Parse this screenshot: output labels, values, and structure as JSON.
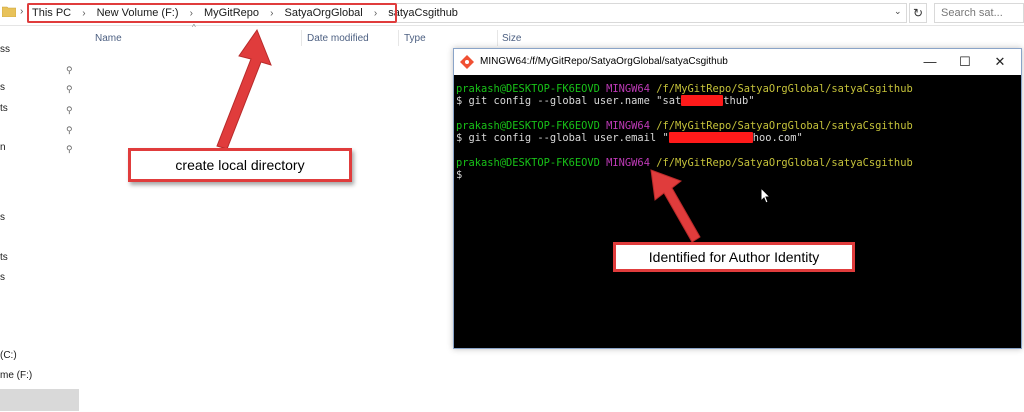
{
  "address_bar": {
    "crumbs": [
      "This PC",
      "New Volume (F:)",
      "MyGitRepo",
      "SatyaOrgGlobal",
      "satyaCsgithub"
    ],
    "search_placeholder": "Search sat..."
  },
  "nav": {
    "items": [
      "ss",
      "s",
      "ts",
      "",
      "n",
      "",
      "s",
      "",
      "ts",
      "s",
      "(C:)",
      "me (F:)"
    ]
  },
  "columns": [
    "Name",
    "Date modified",
    "Type",
    "Size"
  ],
  "callouts": {
    "local_dir": "create local directory",
    "author_identity": "Identified for Author Identity"
  },
  "terminal": {
    "title": "MINGW64:/f/MyGitRepo/SatyaOrgGlobal/satyaCsgithub",
    "user_host": "prakash@DESKTOP-FK6EOVD",
    "env": "MINGW64",
    "path": "/f/MyGitRepo/SatyaOrgGlobal/satyaCsgithub",
    "cmd1_prefix": "$ git config --global user.name \"sat",
    "cmd1_suffix": "thub\"",
    "cmd2_prefix": "$ git config --global user.email \"",
    "cmd2_suffix": "hoo.com\"",
    "prompt": "$"
  },
  "colors": {
    "callout_border": "#e03c3c",
    "arrow": "#e03c3c",
    "redaction": "#ff1a1a"
  }
}
